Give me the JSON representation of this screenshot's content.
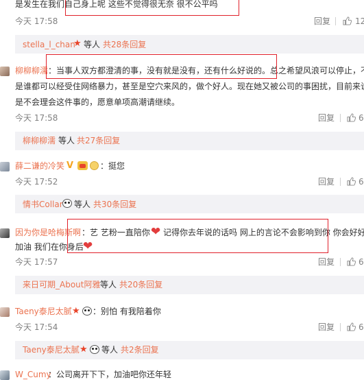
{
  "comments": [
    {
      "text": "是发生在我们自己身上呢 这些不觉得很无奈 很不公平吗",
      "time": "今天 17:58",
      "reply": "回复",
      "likes": "12",
      "sub": {
        "user": "stella_l_chan",
        "suffix": "等人",
        "count": "共28条回复"
      }
    },
    {
      "user": "柳柳柳濡",
      "line1": "：当事人双方都澄清的事，没有就是没有，还有什么好说的。总之希望风浪可以停止，不",
      "line2": "是谁都可以经受住网络暴力，甚至是空穴来风的，做个好人。现在她又被公司的事困扰，目前来说",
      "line3": "是不会理会这件事的，愿意单项高潮请继续。",
      "time": "今天 17:58",
      "reply": "回复",
      "likes": "6",
      "sub": {
        "user": "柳柳柳濡",
        "suffix": "等人",
        "count": "共27条回复"
      }
    },
    {
      "user": "薛二谦的冷笑",
      "text": "：挺您",
      "time": "今天 17:52",
      "reply": "回复",
      "likes": "6",
      "sub": {
        "user": "情书Collar",
        "suffix": "等人",
        "count": "共30条回复"
      }
    },
    {
      "user": "因为你是哈梅斯啊",
      "line1a": "：艺 艺粉一直陪你",
      "line1b": "记得你去年说的话吗 网上的言论不会影响到你 你会好好",
      "line2": "加油 我们在你身后",
      "time": "今天 17:57",
      "reply": "回复",
      "likes": "6",
      "sub": {
        "user": "来日可期_About阿雅",
        "suffix": "等人",
        "count": "共20条回复"
      }
    },
    {
      "user": "Taeny泰尼太腻",
      "text": "：别怕 有我陪着你",
      "time": "今天 17:54",
      "reply": "回复",
      "likes": "6",
      "sub": {
        "user": "Taeny泰尼太腻",
        "suffix": "等人",
        "count": "共2条回复"
      }
    },
    {
      "user": "W_Cumy",
      "text": "：公司离开下下，加油吧你还年轻"
    }
  ],
  "colors": {
    "link": "#eb7350",
    "highlight_box": "#e0202a",
    "band": "#f2f2f5"
  }
}
